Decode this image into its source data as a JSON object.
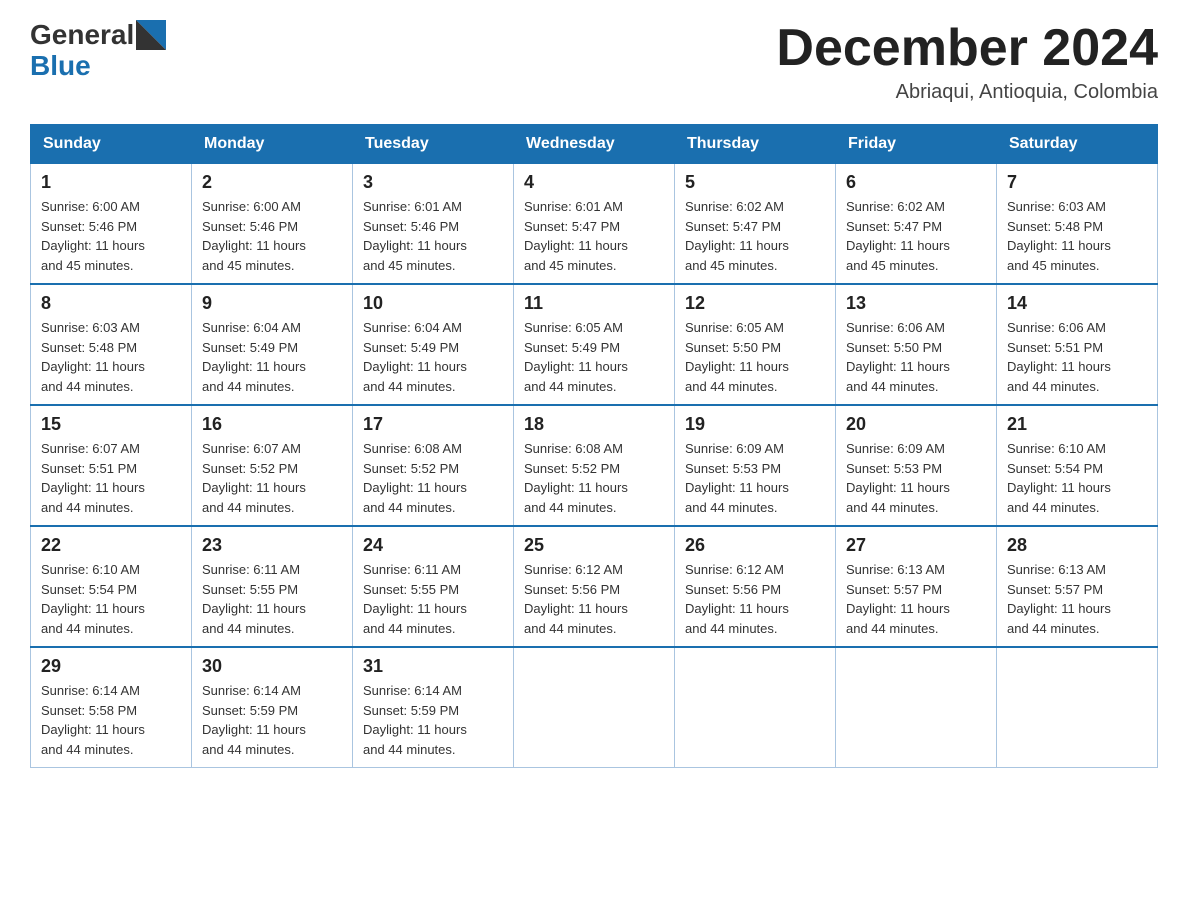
{
  "header": {
    "logo_general": "General",
    "logo_blue": "Blue",
    "month_title": "December 2024",
    "location": "Abriaqui, Antioquia, Colombia"
  },
  "days_of_week": [
    "Sunday",
    "Monday",
    "Tuesday",
    "Wednesday",
    "Thursday",
    "Friday",
    "Saturday"
  ],
  "weeks": [
    [
      {
        "day": "1",
        "sunrise": "6:00 AM",
        "sunset": "5:46 PM",
        "daylight": "11 hours and 45 minutes."
      },
      {
        "day": "2",
        "sunrise": "6:00 AM",
        "sunset": "5:46 PM",
        "daylight": "11 hours and 45 minutes."
      },
      {
        "day": "3",
        "sunrise": "6:01 AM",
        "sunset": "5:46 PM",
        "daylight": "11 hours and 45 minutes."
      },
      {
        "day": "4",
        "sunrise": "6:01 AM",
        "sunset": "5:47 PM",
        "daylight": "11 hours and 45 minutes."
      },
      {
        "day": "5",
        "sunrise": "6:02 AM",
        "sunset": "5:47 PM",
        "daylight": "11 hours and 45 minutes."
      },
      {
        "day": "6",
        "sunrise": "6:02 AM",
        "sunset": "5:47 PM",
        "daylight": "11 hours and 45 minutes."
      },
      {
        "day": "7",
        "sunrise": "6:03 AM",
        "sunset": "5:48 PM",
        "daylight": "11 hours and 45 minutes."
      }
    ],
    [
      {
        "day": "8",
        "sunrise": "6:03 AM",
        "sunset": "5:48 PM",
        "daylight": "11 hours and 44 minutes."
      },
      {
        "day": "9",
        "sunrise": "6:04 AM",
        "sunset": "5:49 PM",
        "daylight": "11 hours and 44 minutes."
      },
      {
        "day": "10",
        "sunrise": "6:04 AM",
        "sunset": "5:49 PM",
        "daylight": "11 hours and 44 minutes."
      },
      {
        "day": "11",
        "sunrise": "6:05 AM",
        "sunset": "5:49 PM",
        "daylight": "11 hours and 44 minutes."
      },
      {
        "day": "12",
        "sunrise": "6:05 AM",
        "sunset": "5:50 PM",
        "daylight": "11 hours and 44 minutes."
      },
      {
        "day": "13",
        "sunrise": "6:06 AM",
        "sunset": "5:50 PM",
        "daylight": "11 hours and 44 minutes."
      },
      {
        "day": "14",
        "sunrise": "6:06 AM",
        "sunset": "5:51 PM",
        "daylight": "11 hours and 44 minutes."
      }
    ],
    [
      {
        "day": "15",
        "sunrise": "6:07 AM",
        "sunset": "5:51 PM",
        "daylight": "11 hours and 44 minutes."
      },
      {
        "day": "16",
        "sunrise": "6:07 AM",
        "sunset": "5:52 PM",
        "daylight": "11 hours and 44 minutes."
      },
      {
        "day": "17",
        "sunrise": "6:08 AM",
        "sunset": "5:52 PM",
        "daylight": "11 hours and 44 minutes."
      },
      {
        "day": "18",
        "sunrise": "6:08 AM",
        "sunset": "5:52 PM",
        "daylight": "11 hours and 44 minutes."
      },
      {
        "day": "19",
        "sunrise": "6:09 AM",
        "sunset": "5:53 PM",
        "daylight": "11 hours and 44 minutes."
      },
      {
        "day": "20",
        "sunrise": "6:09 AM",
        "sunset": "5:53 PM",
        "daylight": "11 hours and 44 minutes."
      },
      {
        "day": "21",
        "sunrise": "6:10 AM",
        "sunset": "5:54 PM",
        "daylight": "11 hours and 44 minutes."
      }
    ],
    [
      {
        "day": "22",
        "sunrise": "6:10 AM",
        "sunset": "5:54 PM",
        "daylight": "11 hours and 44 minutes."
      },
      {
        "day": "23",
        "sunrise": "6:11 AM",
        "sunset": "5:55 PM",
        "daylight": "11 hours and 44 minutes."
      },
      {
        "day": "24",
        "sunrise": "6:11 AM",
        "sunset": "5:55 PM",
        "daylight": "11 hours and 44 minutes."
      },
      {
        "day": "25",
        "sunrise": "6:12 AM",
        "sunset": "5:56 PM",
        "daylight": "11 hours and 44 minutes."
      },
      {
        "day": "26",
        "sunrise": "6:12 AM",
        "sunset": "5:56 PM",
        "daylight": "11 hours and 44 minutes."
      },
      {
        "day": "27",
        "sunrise": "6:13 AM",
        "sunset": "5:57 PM",
        "daylight": "11 hours and 44 minutes."
      },
      {
        "day": "28",
        "sunrise": "6:13 AM",
        "sunset": "5:57 PM",
        "daylight": "11 hours and 44 minutes."
      }
    ],
    [
      {
        "day": "29",
        "sunrise": "6:14 AM",
        "sunset": "5:58 PM",
        "daylight": "11 hours and 44 minutes."
      },
      {
        "day": "30",
        "sunrise": "6:14 AM",
        "sunset": "5:59 PM",
        "daylight": "11 hours and 44 minutes."
      },
      {
        "day": "31",
        "sunrise": "6:14 AM",
        "sunset": "5:59 PM",
        "daylight": "11 hours and 44 minutes."
      },
      null,
      null,
      null,
      null
    ]
  ],
  "labels": {
    "sunrise": "Sunrise:",
    "sunset": "Sunset:",
    "daylight": "Daylight:"
  }
}
